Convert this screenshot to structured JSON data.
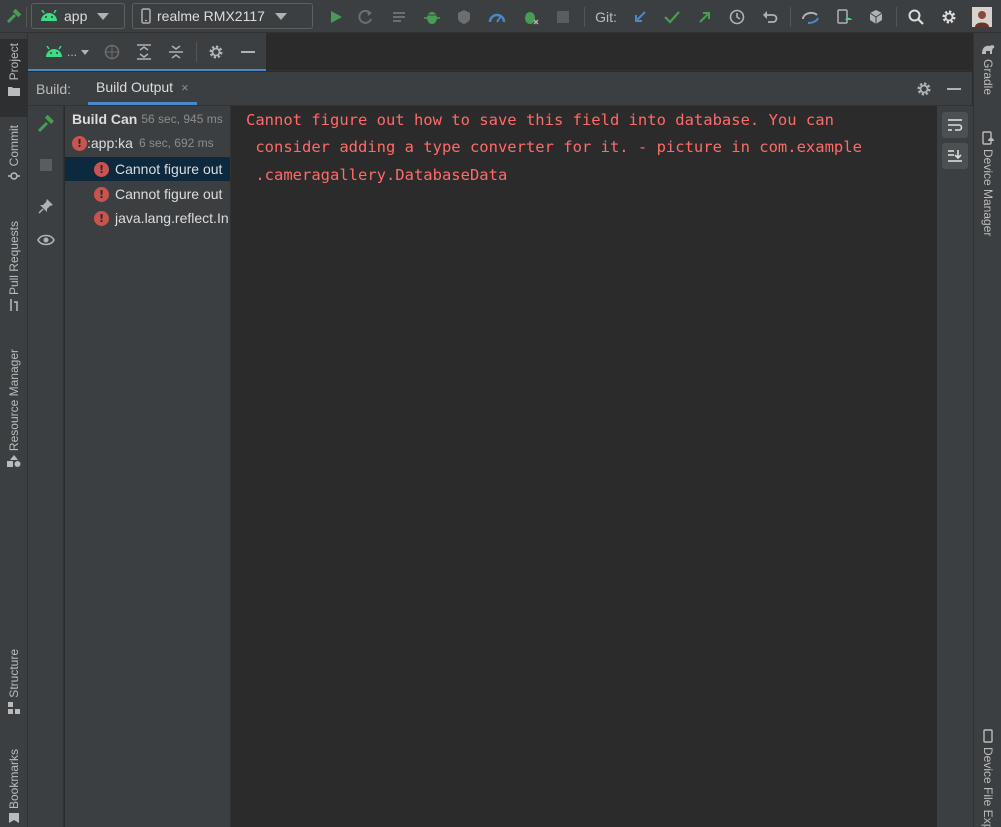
{
  "toolbar": {
    "config_label": "app",
    "device_label": "realme RMX2117",
    "git_label": "Git:"
  },
  "left_strip": {
    "tabs": [
      "Project",
      "Commit",
      "Pull Requests",
      "Resource Manager",
      "Structure",
      "Bookmarks"
    ]
  },
  "right_strip": {
    "tabs": [
      "Gradle",
      "Device Manager",
      "Device File Explorer"
    ]
  },
  "subbar": {
    "device_dots": "..."
  },
  "build": {
    "label": "Build:",
    "tab_label": "Build Output",
    "tab_close": "×"
  },
  "tree": {
    "items": [
      {
        "text": "Build Can",
        "duration": "56 sec, 945 ms"
      },
      {
        "text": ":app:ka",
        "duration": "6 sec, 692 ms"
      },
      {
        "text": "Cannot figure out"
      },
      {
        "text": "Cannot figure out"
      },
      {
        "text": "java.lang.reflect.In"
      }
    ]
  },
  "console": {
    "lines": [
      "Cannot figure out how to save this field into database. You can",
      " consider adding a type converter for it. - picture in com.example",
      " .cameragallery.DatabaseData"
    ]
  },
  "colors": {
    "error_text": "#ff6b68",
    "accent_blue": "#4a88c7",
    "run_green": "#499c54"
  }
}
